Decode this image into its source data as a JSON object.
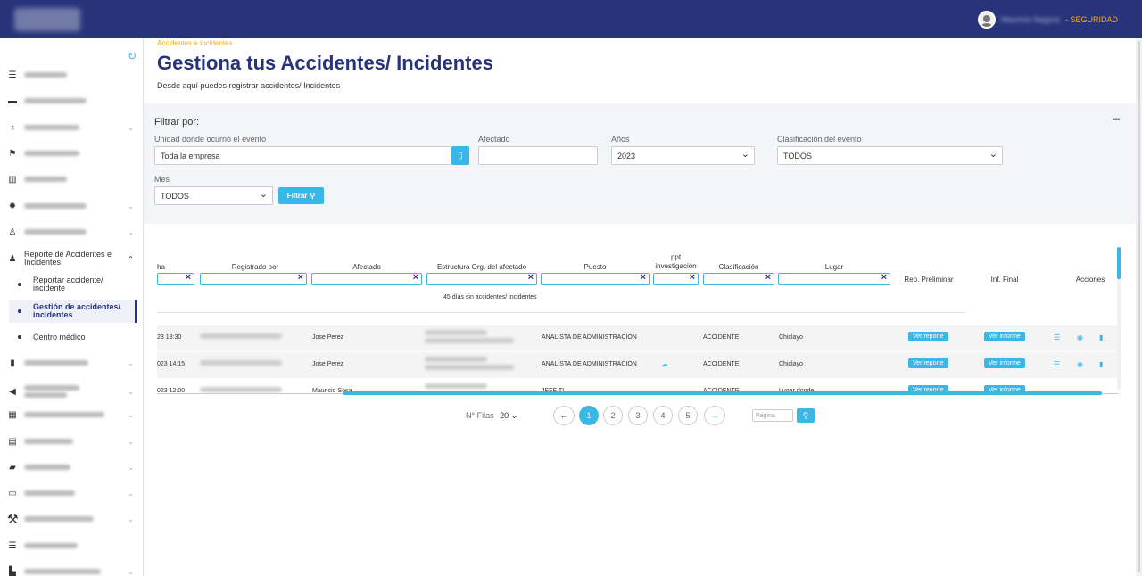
{
  "topbar": {
    "user_name": "Mauricio Nagore",
    "role": "- SEGURIDAD"
  },
  "sidebar": {
    "items": [
      {
        "label": "Gestión SST",
        "icon": "list-icon"
      },
      {
        "label": "Gestión Vehículos",
        "icon": "car-icon"
      },
      {
        "label": "Capacitaciones",
        "icon": "award-icon"
      },
      {
        "label": "Elecciones SST",
        "icon": "flag-icon"
      },
      {
        "label": "Estadísticas",
        "icon": "chart-icon"
      },
      {
        "label": "Gestión Covid-19",
        "icon": "virus-icon"
      },
      {
        "label": "Salud ocupacional",
        "icon": "doctor-icon"
      },
      {
        "label": "Reporte de Accidentes e Incidentes",
        "icon": "user-report-icon"
      },
      {
        "label": "Gestión Checklist",
        "icon": "bookmark-icon"
      },
      {
        "label": "Reporte de actos, condiciones y OPS",
        "icon": "megaphone-icon"
      },
      {
        "label": "Gestión de comité SST",
        "icon": "committee-icon"
      },
      {
        "label": "Gestión iperc",
        "icon": "document-icon"
      },
      {
        "label": "Gestión EPP",
        "icon": "box-icon"
      },
      {
        "label": "Inspecciones",
        "icon": "inspection-icon"
      },
      {
        "label": "Requisitos Legales",
        "icon": "gavel-icon"
      },
      {
        "label": "Plan de acción",
        "icon": "tasks-icon"
      },
      {
        "label": "Gestión Documentaria",
        "icon": "file-icon"
      }
    ],
    "subitems": [
      "Reportar accidente/ incidente",
      "Gestión de accidentes/ incidentes",
      "Centro médico"
    ]
  },
  "page": {
    "breadcrumb": "Accidentes e Incidentes",
    "title": "Gestiona tus Accidentes/ Incidentes",
    "subtitle": "Desde aquí puedes registrar accidentes/ Incidentes"
  },
  "filters": {
    "title": "Filtrar por:",
    "collapse": "−",
    "unidad_label": "Unidad donde ocurrió el evento",
    "unidad_value": "Toda la empresa",
    "afectado_label": "Afectado",
    "afectado_value": "",
    "anios_label": "Años",
    "anios_value": "2023",
    "clasif_label": "Clasificación del evento",
    "clasif_value": "TODOS",
    "mes_label": "Mes",
    "mes_value": "TODOS",
    "filtrar_label": "Filtrar"
  },
  "table": {
    "headers": [
      "ha",
      "Registrado por",
      "Afectado",
      "Estructura Org. del afectado",
      "Puesto",
      "ppt investigación",
      "Clasificación",
      "Lugar",
      "Rep. Preliminar",
      "Inf. Final",
      "Acciones"
    ],
    "no_days": "45 días sin accidentes/ incidentes",
    "rows": [
      {
        "fecha": "23 18:30",
        "afectado": "Jose Perez",
        "puesto": "ANALISTA DE ADMINISTRACION",
        "clasificacion": "ACCIDENTE",
        "lugar": "Chiclayo",
        "rep": "Ver reporte",
        "inf": "Ver informe"
      },
      {
        "fecha": "023 14:15",
        "afectado": "Jose Perez",
        "puesto": "ANALISTA DE ADMINISTRACION",
        "clasificacion": "ACCIDENTE",
        "lugar": "Chiclayo",
        "rep": "Ver reporte",
        "inf": "Ver informe"
      },
      {
        "fecha": "023 12:00",
        "afectado": "Mauricio Sosa",
        "puesto": "JEFE TI",
        "clasificacion": "ACCIDENTE",
        "lugar": "Lugar donde",
        "rep": "Ver reporte",
        "inf": "Ver informe"
      }
    ]
  },
  "pagination": {
    "rows_label": "N° Filas",
    "rows_value": "20",
    "pages": [
      "1",
      "2",
      "3",
      "4",
      "5"
    ],
    "page_placeholder": "Página"
  }
}
